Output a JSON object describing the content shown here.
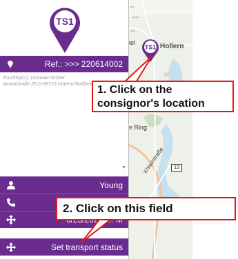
{
  "stop_marker": {
    "label": "TS1",
    "color": "#6a2c8f"
  },
  "map": {
    "labels": {
      "town": "Hollern",
      "partial_left": "hel",
      "street_ring": "er Ring",
      "street_kreuz": "Kreuzstraße",
      "road_number": "13"
    }
  },
  "reference": {
    "text": "Ref.: >>> 220614002",
    "icon": "location-pin-icon"
  },
  "address": {
    "line1": "TourStop(1): Donauer GmbH",
    "line2": "Amselstraße 25,D-85716 Unterschleißheim"
  },
  "rows": [
    {
      "icon": "person-icon",
      "value": "Young"
    },
    {
      "icon": "phone-icon",
      "value": "+"
    },
    {
      "icon": "move-icon",
      "value": "6/23/2022 … M"
    },
    {
      "icon": "move-icon",
      "value": "Set transport status"
    }
  ],
  "callouts": {
    "step1_line1": "1. Click on the",
    "step1_line2": "consignor's location",
    "step2": "2. Click on this field"
  },
  "colors": {
    "accent": "#6a2c8f",
    "callout_border": "#e0191b"
  }
}
